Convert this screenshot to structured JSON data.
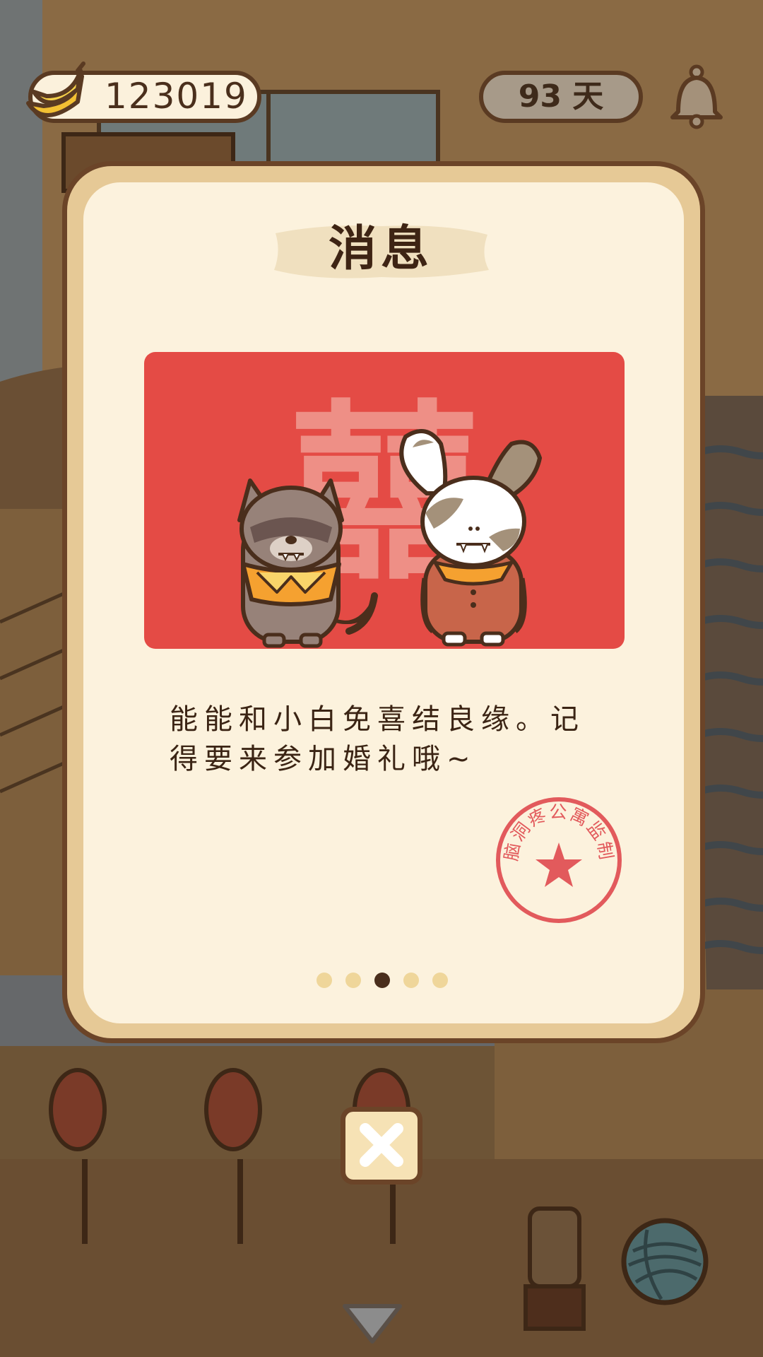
{
  "hud": {
    "banana_count": "123019",
    "days": "93 天"
  },
  "modal": {
    "title": "消息",
    "picture_character": "囍",
    "message": "能能和小白免喜结良缘。记得要来参加婚礼哦~",
    "stamp_text": "脑洞疼公寓监制",
    "page_count": 5,
    "current_page": 3
  },
  "colors": {
    "card_red": "#e44b45",
    "stamp_red": "#e25a5c",
    "modal_border": "#6b4428",
    "modal_fill": "#fcf2dd"
  },
  "icons": {
    "banana": "banana-icon",
    "bell": "bell-icon",
    "close": "close-icon",
    "arrow": "chevron-down-icon",
    "yarn": "yarn-ball-icon"
  }
}
